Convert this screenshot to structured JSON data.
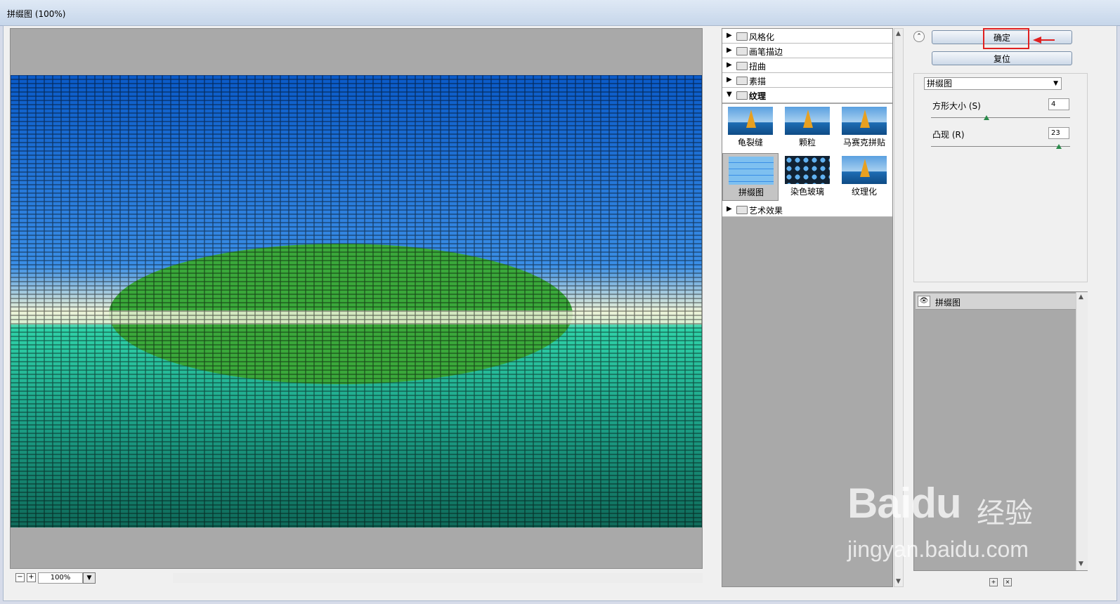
{
  "window": {
    "title": "拼缀图 (100%)"
  },
  "preview": {
    "zoom": "100%",
    "minus": "−",
    "plus": "+"
  },
  "filters": {
    "categories": [
      {
        "label": "风格化",
        "expanded": false
      },
      {
        "label": "画笔描边",
        "expanded": false
      },
      {
        "label": "扭曲",
        "expanded": false
      },
      {
        "label": "素描",
        "expanded": false
      },
      {
        "label": "纹理",
        "expanded": true
      },
      {
        "label": "艺术效果",
        "expanded": false
      }
    ],
    "texture_items": [
      {
        "label": "龟裂缝",
        "selected": false
      },
      {
        "label": "颗粒",
        "selected": false
      },
      {
        "label": "马赛克拼贴",
        "selected": false
      },
      {
        "label": "拼缀图",
        "selected": true
      },
      {
        "label": "染色玻璃",
        "selected": false
      },
      {
        "label": "纹理化",
        "selected": false
      }
    ]
  },
  "buttons": {
    "ok": "确定",
    "reset": "复位"
  },
  "settings": {
    "filter_select": "拼缀图",
    "params": [
      {
        "label": "方形大小 (S)",
        "value": "4",
        "level": 0.4
      },
      {
        "label": "凸现 (R)",
        "value": "23",
        "level": 0.92
      }
    ]
  },
  "layers": {
    "items": [
      {
        "label": "拼缀图"
      }
    ]
  },
  "watermark": {
    "logo": "Baidu",
    "cn": "经验",
    "url": "jingyan.baidu.com"
  },
  "colors": {
    "highlight": "#e02020",
    "sky": "#1f78d8",
    "island": "#3aa83a",
    "sea": "#2ab59a"
  }
}
